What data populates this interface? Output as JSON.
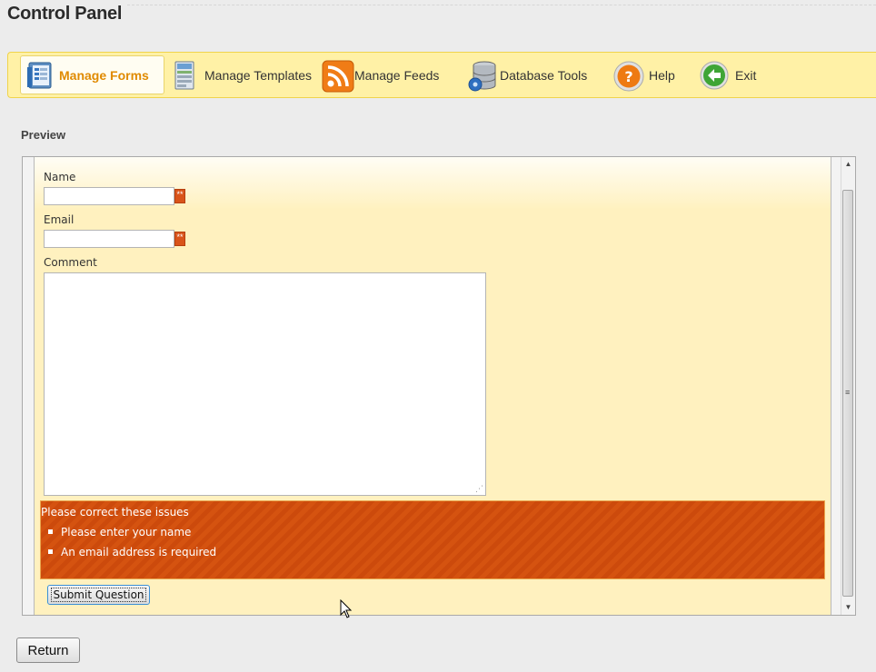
{
  "page": {
    "title": "Control Panel"
  },
  "toolbar": {
    "items": [
      {
        "label": "Manage Forms",
        "icon": "forms-icon",
        "active": true
      },
      {
        "label": "Manage Templates",
        "icon": "template-icon",
        "active": false
      },
      {
        "label": "Manage Feeds",
        "icon": "rss-icon",
        "active": false
      },
      {
        "label": "Database Tools",
        "icon": "database-icon",
        "active": false
      },
      {
        "label": "Help",
        "icon": "help-icon",
        "active": false
      },
      {
        "label": "Exit",
        "icon": "exit-icon",
        "active": false
      }
    ],
    "active_color": "#e08a00",
    "background": "#fff1a6"
  },
  "preview": {
    "heading": "Preview",
    "form": {
      "name_label": "Name",
      "name_value": "",
      "email_label": "Email",
      "email_value": "",
      "comment_label": "Comment",
      "comment_value": "",
      "required_marker": "**"
    },
    "errors": {
      "title": "Please correct these issues",
      "items": [
        "Please enter your name",
        "An email address is required"
      ],
      "color": "#d55310"
    },
    "submit_label": "Submit Question"
  },
  "footer": {
    "return_label": "Return"
  }
}
